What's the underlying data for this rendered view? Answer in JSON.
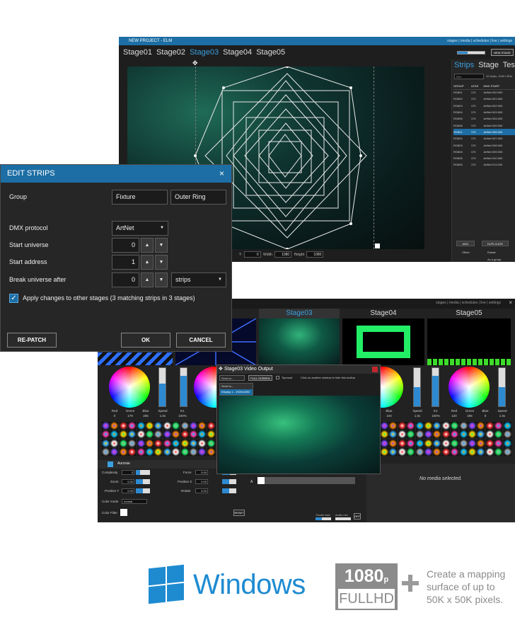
{
  "top_window": {
    "title": "NEW PROJECT - ELM",
    "menu": "stages | media | schedules | live | settings",
    "stage_tabs": [
      "Stage01",
      "Stage02",
      "Stage03",
      "Stage04",
      "Stage05"
    ],
    "active_stage": "Stage03",
    "new_stage_button": "NEW STAGE",
    "bottom_bar": {
      "y_label": "Y",
      "y_value": "0",
      "width_label": "Width",
      "width_value": "1080",
      "height_label": "Height",
      "height_value": "1080"
    },
    "right_panel": {
      "tabs": [
        "Strips",
        "Stage",
        "Testing"
      ],
      "filter_placeholder": "filter",
      "count_text": "12 strips, 2040 LEDs",
      "columns": [
        "GROUP",
        "LEDS",
        "DMX START"
      ],
      "rows": [
        [
          "RG801",
          "170",
          "ArtNet 000:000"
        ],
        [
          "RG802",
          "170",
          "ArtNet 001:000"
        ],
        [
          "RG803",
          "170",
          "ArtNet 002:000"
        ],
        [
          "RG804",
          "170",
          "ArtNet 003:000"
        ],
        [
          "RG805",
          "170",
          "ArtNet 004:000"
        ],
        [
          "RG806",
          "170",
          "ArtNet 005:000"
        ],
        [
          "RG801",
          "170",
          "ArtNet 006:000"
        ],
        [
          "RG802",
          "170",
          "ArtNet 007:000"
        ],
        [
          "RG803",
          "170",
          "ArtNet 008:000"
        ],
        [
          "RG804",
          "170",
          "ArtNet 009:000"
        ],
        [
          "RG805",
          "170",
          "ArtNet 010:000"
        ],
        [
          "RG806",
          "170",
          "ArtNet 011:000"
        ]
      ],
      "selected_row": 6,
      "add_button": "ADD",
      "duplicate_button": "DUPLICATE",
      "offset_label": "Offset",
      "rotate_label": "Rotate",
      "as_group_label": "As a group"
    }
  },
  "dialog": {
    "title": "EDIT STRIPS",
    "close_icon": "×",
    "group_label": "Group",
    "group_value_1": "Fixture",
    "group_value_2": "Outer Ring",
    "dmx_protocol_label": "DMX protocol",
    "dmx_protocol_value": "ArtNet",
    "start_universe_label": "Start universe",
    "start_universe_value": "0",
    "start_address_label": "Start address",
    "start_address_value": "1",
    "break_universe_label": "Break universe after",
    "break_universe_value": "0",
    "break_unit_value": "strips",
    "apply_label": "Apply changes to other stages (3 matching strips in 3 stages)",
    "apply_checked": true,
    "repatch_button": "RE-PATCH",
    "ok_button": "OK",
    "cancel_button": "CANCEL"
  },
  "bottom_window": {
    "menu": "stages | media | schedules | live | settings",
    "close_icon": "×",
    "stage_tabs": [
      "Stage03",
      "Stage04",
      "Stage05"
    ],
    "active_stage": "Stage03",
    "color_labels": [
      "Red",
      "Green",
      "Blue",
      "Speed",
      "Int."
    ],
    "color_values_left": [
      "0",
      "179",
      "255",
      "1.0x",
      "100%"
    ],
    "color_values_right": [
      "0",
      "104",
      "1.0x",
      "100%",
      "120",
      "255",
      "0",
      "1.0x"
    ],
    "layer_name": "Aurorae",
    "controls": [
      {
        "label": "Complexity",
        "value": "3"
      },
      {
        "label": "Zoom",
        "value": "0.00"
      },
      {
        "label": "Position Y",
        "value": "0.00"
      },
      {
        "label": "Force",
        "value": "5.50"
      },
      {
        "label": "Position X",
        "value": "0.00"
      },
      {
        "label": "Rotate",
        "value": "0.00"
      }
    ],
    "color_mode_label": "Color mode",
    "color_mode_value": "normal",
    "color_filter_label": "Color Filter",
    "reset_button": "RESET",
    "deck_label": "A",
    "thumb_size_label": "Thumb size",
    "audio_mix_label": "Audio mix",
    "off_button": "OFF",
    "no_media_text": "No media selected."
  },
  "video_output": {
    "title": "Stage03 Video Output",
    "send_to_label": "Send to...",
    "fullscreen_button": "FULL SCREEN",
    "topmost_label": "Topmost",
    "hint": "Click on another window to hide this toolbar",
    "menu_items": [
      "Send to...",
      "Display 1 - 1920x1080"
    ]
  },
  "footer": {
    "windows_text": "Windows",
    "hd_top": "1080",
    "hd_top_suffix": "p",
    "hd_bottom": "FULLHD",
    "tagline": [
      "Create a mapping",
      "surface of up to",
      "50K x 50K pixels."
    ]
  },
  "colors": {
    "accent": "#1c6ea4",
    "windows_blue": "#1e8bd1",
    "hd_gray": "#8b8b8b"
  }
}
